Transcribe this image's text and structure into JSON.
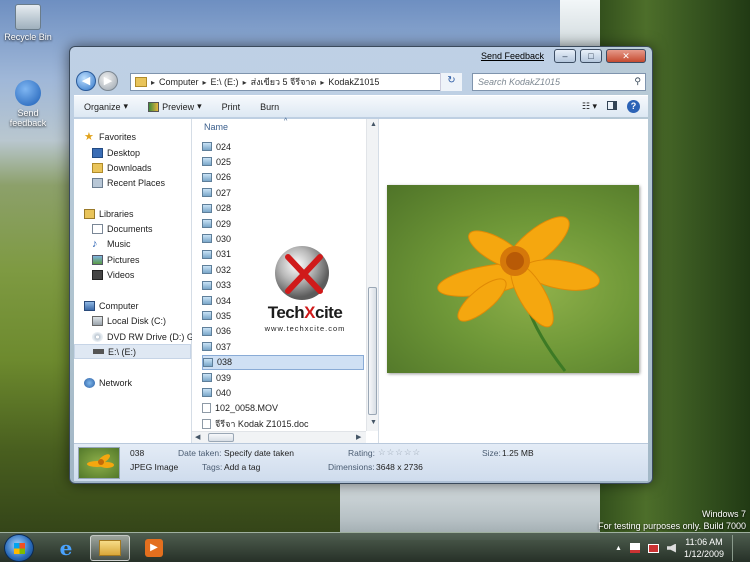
{
  "desktop": {
    "icons": [
      {
        "label": "Recycle Bin",
        "icon": "recycle-bin-icon"
      },
      {
        "label": "Send feedback",
        "icon": "send-feedback-icon"
      }
    ],
    "windows_version": "Windows 7",
    "build_text": "For testing purposes only. Build 7000"
  },
  "window": {
    "send_feedback": "Send Feedback",
    "minimize": "–",
    "maximize": "□",
    "close": "✕",
    "address": {
      "crumbs": [
        "Computer",
        "E:\\ (E:)",
        "ส่งเขียว 5 จีรีจาด",
        "KodakZ1015"
      ]
    },
    "search_placeholder": "Search KodakZ1015",
    "toolbar": {
      "organize": "Organize",
      "preview": "Preview",
      "print": "Print",
      "burn": "Burn"
    },
    "nav": {
      "favorites": "Favorites",
      "desktop": "Desktop",
      "downloads": "Downloads",
      "recent": "Recent Places",
      "libraries": "Libraries",
      "documents": "Documents",
      "music": "Music",
      "pictures": "Pictures",
      "videos": "Videos",
      "computer": "Computer",
      "local_disk": "Local Disk (C:)",
      "dvd": "DVD RW Drive (D:) G",
      "e_drive": "E:\\ (E:)",
      "network": "Network"
    },
    "files": {
      "column_name": "Name",
      "items": [
        "024",
        "025",
        "026",
        "027",
        "028",
        "029",
        "030",
        "031",
        "032",
        "033",
        "034",
        "035",
        "036",
        "037",
        "038",
        "039",
        "040",
        "102_0058.MOV",
        "จีรีจา Kodak Z1015.doc"
      ],
      "selected": "038"
    },
    "details": {
      "name": "038",
      "type": "JPEG Image",
      "date_label": "Date taken:",
      "date_value": "Specify date taken",
      "tags_label": "Tags:",
      "tags_value": "Add a tag",
      "rating_label": "Rating:",
      "rating_stars": "☆☆☆☆☆",
      "dimensions_label": "Dimensions:",
      "dimensions_value": "3648 x 2736",
      "size_label": "Size:",
      "size_value": "1.25 MB"
    }
  },
  "watermark": {
    "brand_a": "Tech",
    "brand_x": "X",
    "brand_b": "cite",
    "url": "www.techxcite.com"
  },
  "taskbar": {
    "time": "11:06 AM",
    "date": "1/12/2009",
    "tray_arrow": "▲"
  }
}
